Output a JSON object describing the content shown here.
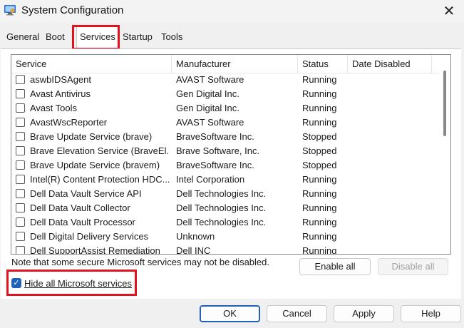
{
  "window": {
    "title": "System Configuration"
  },
  "tabs": [
    {
      "label": "General"
    },
    {
      "label": "Boot"
    },
    {
      "label": "Services"
    },
    {
      "label": "Startup"
    },
    {
      "label": "Tools"
    }
  ],
  "active_tab": "Services",
  "columns": [
    "Service",
    "Manufacturer",
    "Status",
    "Date Disabled"
  ],
  "services": [
    {
      "name": "aswbIDSAgent",
      "manufacturer": "AVAST Software",
      "status": "Running",
      "checked": false
    },
    {
      "name": "Avast Antivirus",
      "manufacturer": "Gen Digital Inc.",
      "status": "Running",
      "checked": false
    },
    {
      "name": "Avast Tools",
      "manufacturer": "Gen Digital Inc.",
      "status": "Running",
      "checked": false
    },
    {
      "name": "AvastWscReporter",
      "manufacturer": "AVAST Software",
      "status": "Running",
      "checked": false
    },
    {
      "name": "Brave Update Service (brave)",
      "manufacturer": "BraveSoftware Inc.",
      "status": "Stopped",
      "checked": false
    },
    {
      "name": "Brave Elevation Service (BraveEl...",
      "manufacturer": "Brave Software, Inc.",
      "status": "Stopped",
      "checked": false
    },
    {
      "name": "Brave Update Service (bravem)",
      "manufacturer": "BraveSoftware Inc.",
      "status": "Stopped",
      "checked": false
    },
    {
      "name": "Intel(R) Content Protection HDC...",
      "manufacturer": "Intel Corporation",
      "status": "Running",
      "checked": false
    },
    {
      "name": "Dell Data Vault Service API",
      "manufacturer": "Dell Technologies Inc.",
      "status": "Running",
      "checked": false
    },
    {
      "name": "Dell Data Vault Collector",
      "manufacturer": "Dell Technologies Inc.",
      "status": "Running",
      "checked": false
    },
    {
      "name": "Dell Data Vault Processor",
      "manufacturer": "Dell Technologies Inc.",
      "status": "Running",
      "checked": false
    },
    {
      "name": "Dell Digital Delivery Services",
      "manufacturer": "Unknown",
      "status": "Running",
      "checked": false
    },
    {
      "name": "Dell SupportAssist Remediation",
      "manufacturer": "Dell INC",
      "status": "Running",
      "checked": false
    }
  ],
  "note": "Note that some secure Microsoft services may not be disabled.",
  "hide_ms": {
    "label": "Hide all Microsoft services",
    "checked": true
  },
  "buttons": {
    "enable_all": "Enable all",
    "disable_all": "Disable all",
    "ok": "OK",
    "cancel": "Cancel",
    "apply": "Apply",
    "help": "Help"
  },
  "icons": {
    "app": "system-config-icon",
    "close": "close-icon",
    "check": "checkmark-icon"
  },
  "colors": {
    "highlight": "#e2131f",
    "accent": "#1f62b8"
  }
}
